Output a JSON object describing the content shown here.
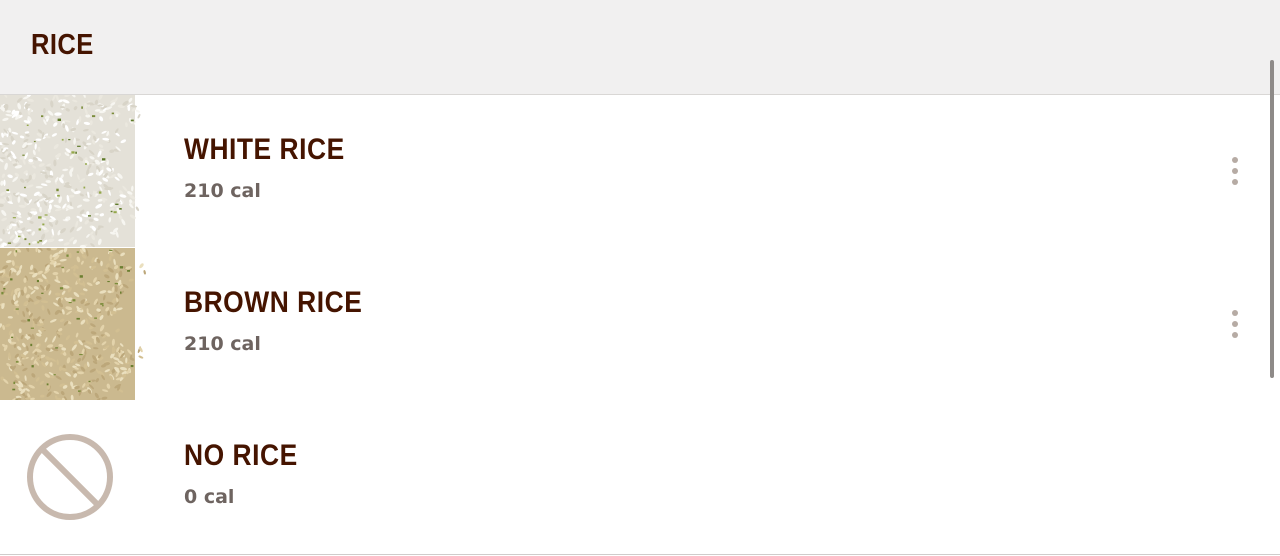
{
  "section": {
    "title": "RICE"
  },
  "options": [
    {
      "name": "WHITE RICE",
      "calories": "210 cal",
      "image": "white-rice-image",
      "icon": "more-vertical-icon"
    },
    {
      "name": "BROWN RICE",
      "calories": "210 cal",
      "image": "brown-rice-image",
      "icon": "more-vertical-icon"
    },
    {
      "name": "NO RICE",
      "calories": "0 cal",
      "image": "no-symbol-icon"
    }
  ],
  "colors": {
    "title_text": "#451400",
    "calorie_text": "#6e6460",
    "header_background": "#f1f0f0",
    "no_symbol": "#c8b9ae",
    "menu_dots": "#b6aba4"
  }
}
